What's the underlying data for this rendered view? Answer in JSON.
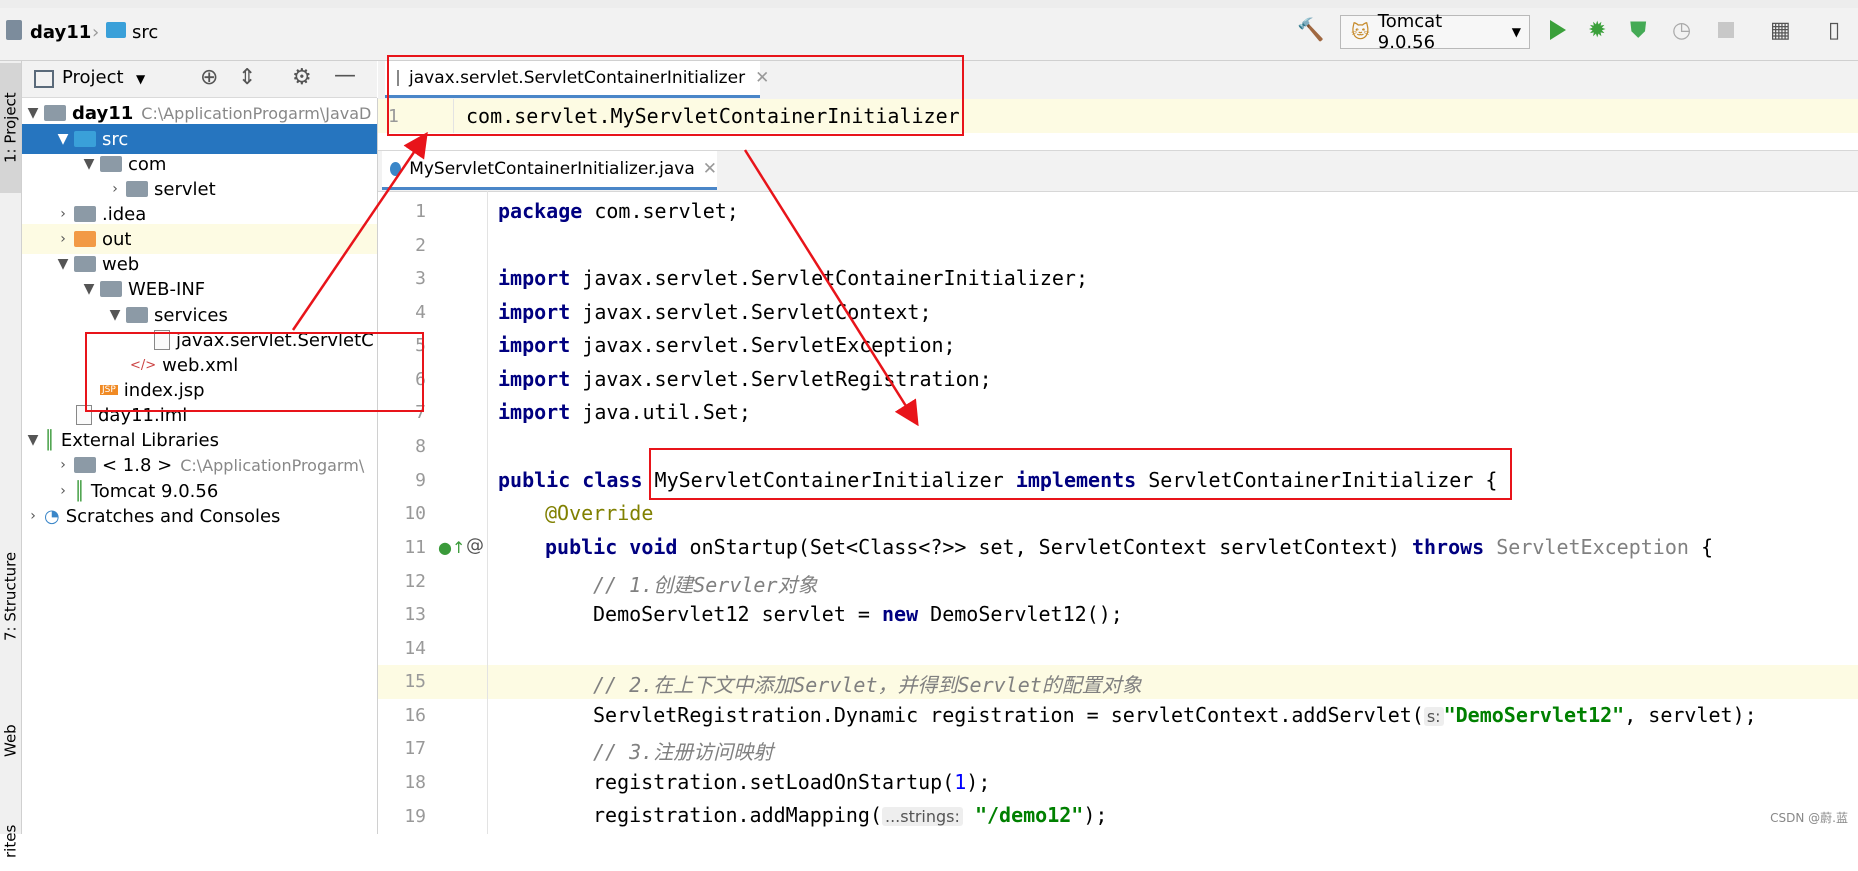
{
  "breadcrumb": {
    "project": "day11",
    "folder": "src"
  },
  "toolbar": {
    "run_config": "Tomcat 9.0.56"
  },
  "left_strip": {
    "project_tab": "1: Project",
    "structure_tab": "7: Structure",
    "web_tab": "Web",
    "favorites_tab": "rites"
  },
  "project_panel": {
    "title": "Project",
    "rows": [
      {
        "label": "day11",
        "path": "C:\\ApplicationProgarm\\JavaD"
      },
      {
        "label": "src"
      },
      {
        "label": "com"
      },
      {
        "label": "servlet"
      },
      {
        "label": ".idea"
      },
      {
        "label": "out"
      },
      {
        "label": "web"
      },
      {
        "label": "WEB-INF"
      },
      {
        "label": "services"
      },
      {
        "label": "javax.servlet.ServletC"
      },
      {
        "label": "web.xml"
      },
      {
        "label": "index.jsp"
      },
      {
        "label": "day11.iml"
      },
      {
        "label": "External Libraries"
      },
      {
        "label": "< 1.8 >",
        "path": "C:\\ApplicationProgarm\\"
      },
      {
        "label": "Tomcat 9.0.56"
      },
      {
        "label": "Scratches and Consoles"
      }
    ]
  },
  "editor_top": {
    "tab_label": "javax.servlet.ServletContainerInitializer",
    "line_number": "1",
    "line_text": "com.servlet.MyServletContainerInitializer"
  },
  "editor_main": {
    "tab_label": "MyServletContainerInitializer.java",
    "line_numbers": [
      "1",
      "2",
      "3",
      "4",
      "5",
      "6",
      "7",
      "8",
      "9",
      "10",
      "11",
      "12",
      "13",
      "14",
      "15",
      "16",
      "17",
      "18",
      "19"
    ],
    "code": {
      "l1_kw": "package",
      "l1_rest": " com.servlet;",
      "imp_kw": "import",
      "l3_rest": " javax.servlet.ServletContainerInitializer;",
      "l4_rest": " javax.servlet.ServletContext;",
      "l5_rest": " javax.servlet.ServletException;",
      "l6_rest": " javax.servlet.ServletRegistration;",
      "l7_rest": " java.util.Set;",
      "l9_kw1": "public class",
      "l9_cls": "MyServletContainerInitializer",
      "l9_kw2": "implements",
      "l9_rest": " ServletContainerInitializer {",
      "l10": "@Override",
      "l11_kw": "public void",
      "l11_a": " onStartup(Set<Class<?>> set, ServletContext servletContext) ",
      "l11_kw2": "throws",
      "l11_ex": "ServletException",
      "l11_end": " {",
      "l12": "// 1.创建Servler对象",
      "l13_a": "DemoServlet12 servlet = ",
      "l13_kw": "new",
      "l13_b": " DemoServlet12();",
      "l15": "// 2.在上下文中添加Servlet，并得到Servlet的配置对象",
      "l16_a": "ServletRegistration.Dynamic registration = servletContext.addServlet(",
      "l16_hint": "s:",
      "l16_str": "\"DemoServlet12\"",
      "l16_b": ", servlet);",
      "l17": "// 3.注册访问映射",
      "l18_a": "registration.setLoadOnStartup(",
      "l18_num": "1",
      "l18_b": ");",
      "l19_a": "registration.addMapping(",
      "l19_hint": "...strings:",
      "l19_str": "\"/demo12\"",
      "l19_b": ");"
    }
  },
  "watermark": "CSDN @蔚.蓝",
  "colors": {
    "selection": "#2675bf",
    "annotation_red": "#e8141a",
    "keyword": "#000080",
    "string": "#008000"
  }
}
